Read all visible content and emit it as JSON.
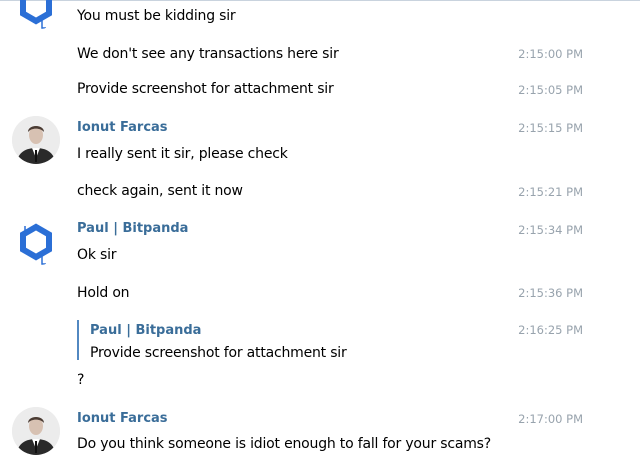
{
  "messages": {
    "m1": {
      "text": "You must be kidding sir"
    },
    "m2": {
      "text": "We don't see any transactions here sir",
      "time": "2:15:00 PM"
    },
    "m3": {
      "text": "Provide screenshot for attachment sir",
      "time": "2:15:05 PM"
    },
    "g2": {
      "sender": "Ionut Farcas",
      "time": "2:15:15 PM",
      "text": "I really sent it sir, please check"
    },
    "m5": {
      "text": "check again, sent it now",
      "time": "2:15:21 PM"
    },
    "g3": {
      "sender": "Paul | Bitpanda",
      "time": "2:15:34 PM",
      "text": "Ok sir"
    },
    "m7": {
      "text": "Hold on",
      "time": "2:15:36 PM"
    },
    "m8": {
      "time": "2:16:25 PM",
      "reply": {
        "sender": "Paul | Bitpanda",
        "text": "Provide screenshot for attachment sir"
      },
      "text": "?"
    },
    "g4": {
      "sender": "Ionut Farcas",
      "time": "2:17:00 PM",
      "text": "Do you think someone is idiot enough to fall for your scams?"
    }
  },
  "colors": {
    "sender": "#3a6d99",
    "timestamp": "#98a3ad",
    "reply_bar": "#5288c1",
    "bitpanda_logo": "#2b6fd6"
  },
  "icons": {
    "bitpanda_avatar": "bitpanda-hexagon-logo",
    "user_avatar": "person-photo"
  }
}
